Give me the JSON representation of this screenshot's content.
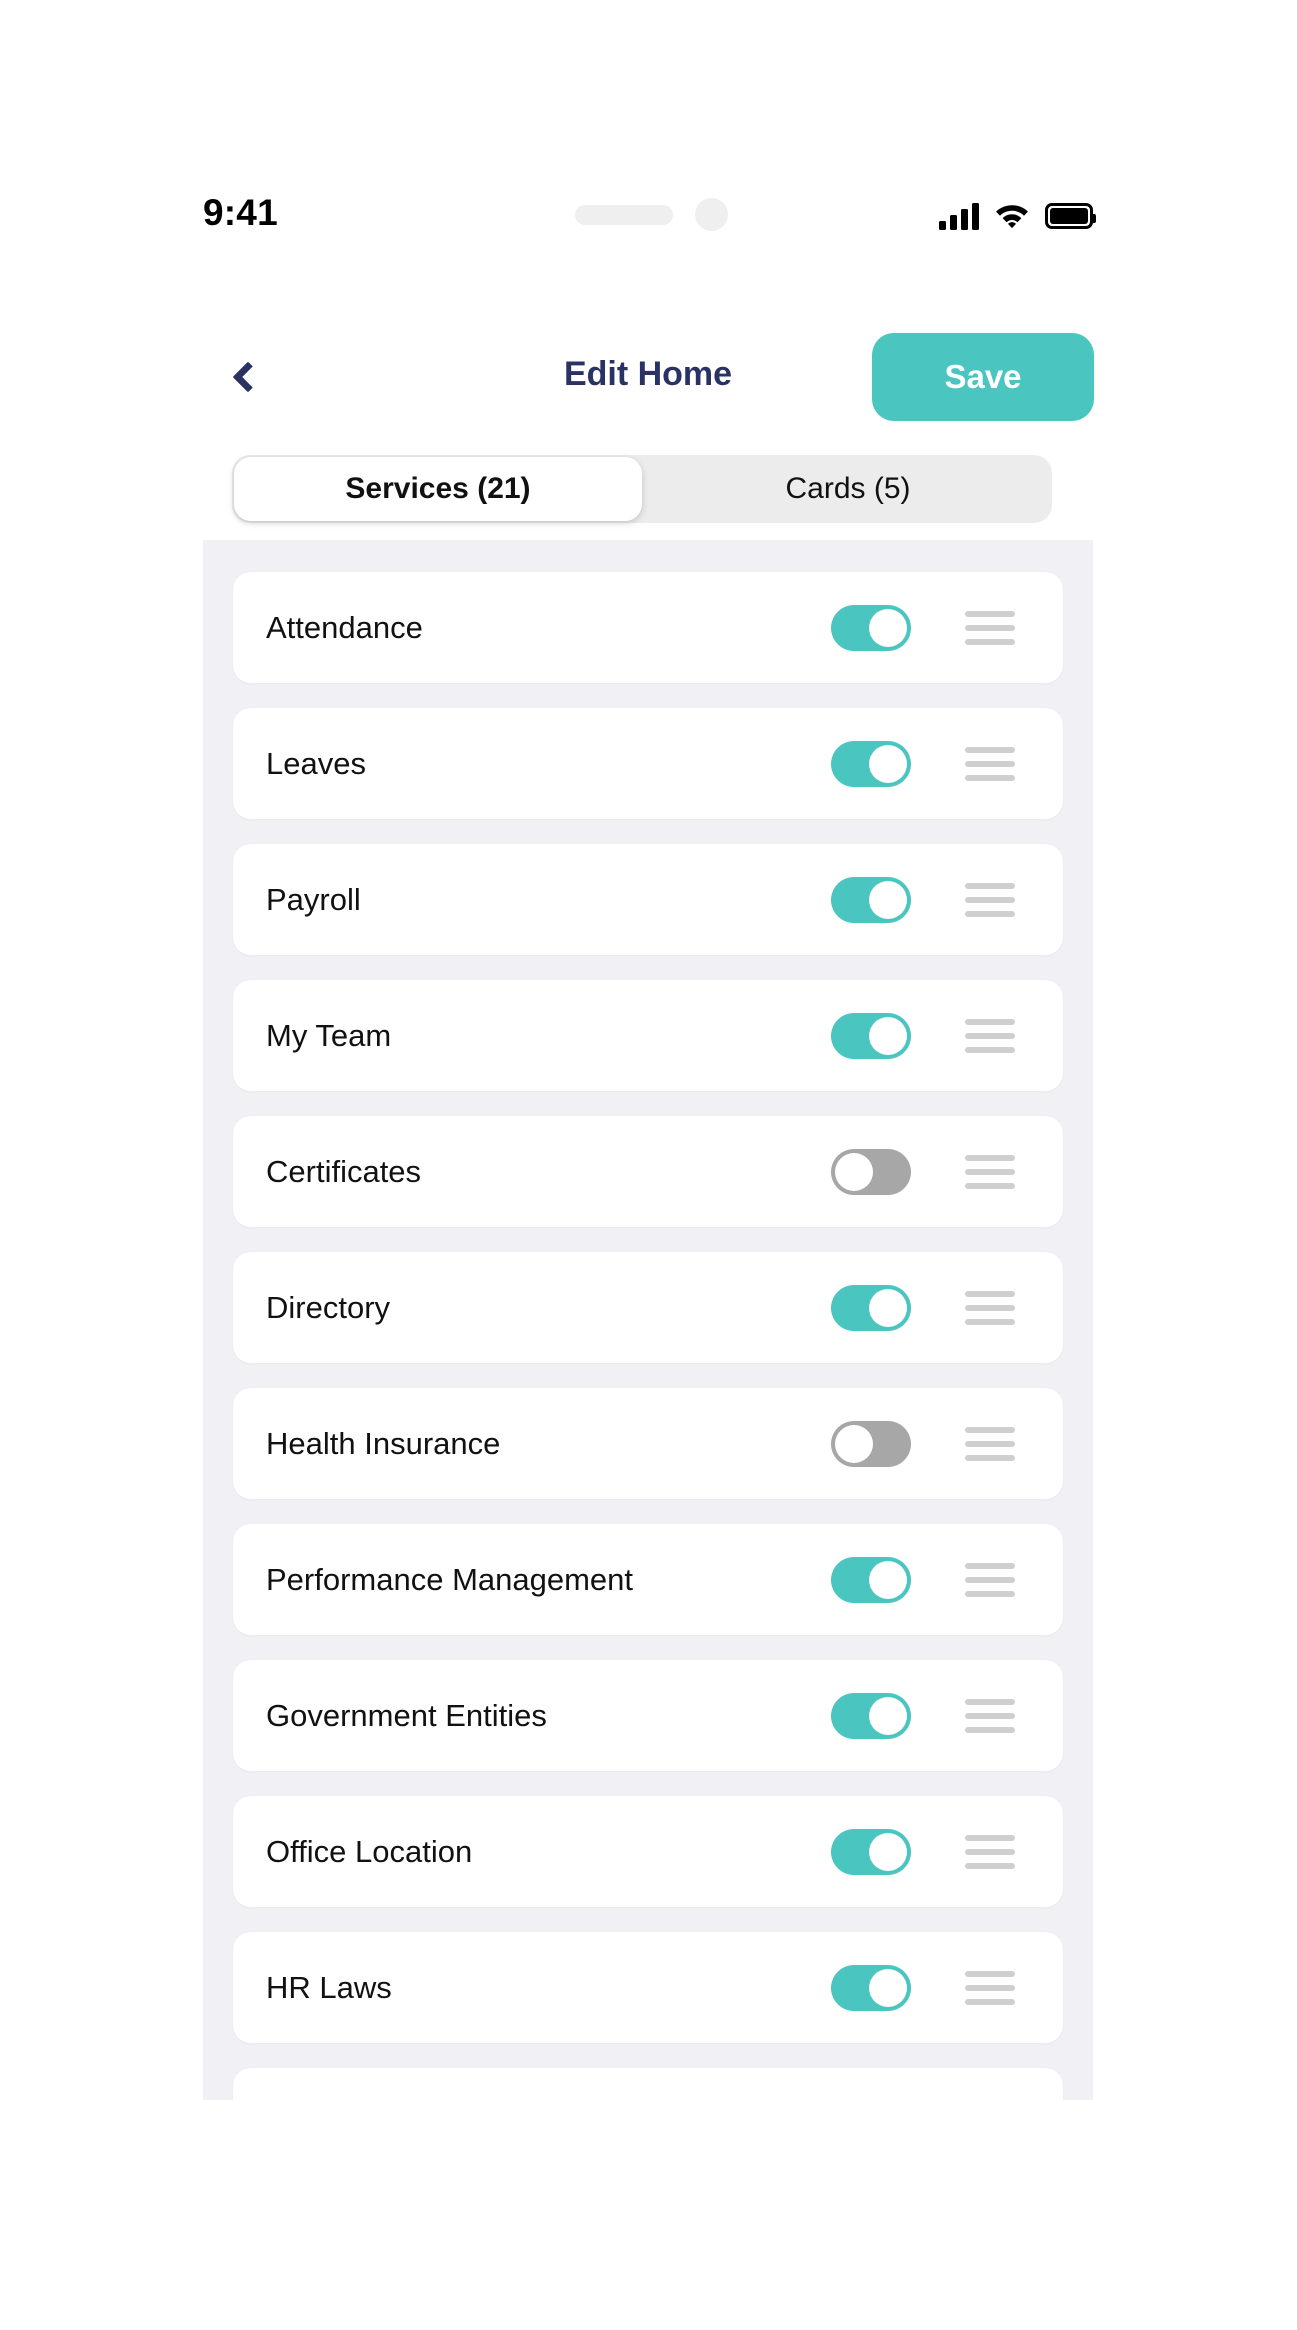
{
  "status_bar": {
    "time": "9:41",
    "icons": [
      "cellular-signal-icon",
      "wifi-icon",
      "battery-icon"
    ]
  },
  "header": {
    "back_icon": "chevron-left-icon",
    "title": "Edit Home",
    "save_label": "Save"
  },
  "tabs": [
    {
      "label": "Services (21)",
      "active": true
    },
    {
      "label": "Cards (5)",
      "active": false
    }
  ],
  "colors": {
    "accent_teal": "#4AC5BF",
    "title_navy": "#2A3263",
    "panel_gray": "#F1F1F5",
    "tab_track": "#ECECEC",
    "toggle_off": "#A7A7A7",
    "drag_handle": "#CFCFCF"
  },
  "list": {
    "items": [
      {
        "label": "Attendance",
        "enabled": true
      },
      {
        "label": "Leaves",
        "enabled": true
      },
      {
        "label": "Payroll",
        "enabled": true
      },
      {
        "label": "My Team",
        "enabled": true
      },
      {
        "label": "Certificates",
        "enabled": false
      },
      {
        "label": "Directory",
        "enabled": true
      },
      {
        "label": "Health Insurance",
        "enabled": false
      },
      {
        "label": "Performance Management",
        "enabled": true
      },
      {
        "label": "Government Entities",
        "enabled": true
      },
      {
        "label": "Office Location",
        "enabled": true
      },
      {
        "label": "HR Laws",
        "enabled": true
      },
      {
        "label": "",
        "enabled": true
      }
    ]
  }
}
